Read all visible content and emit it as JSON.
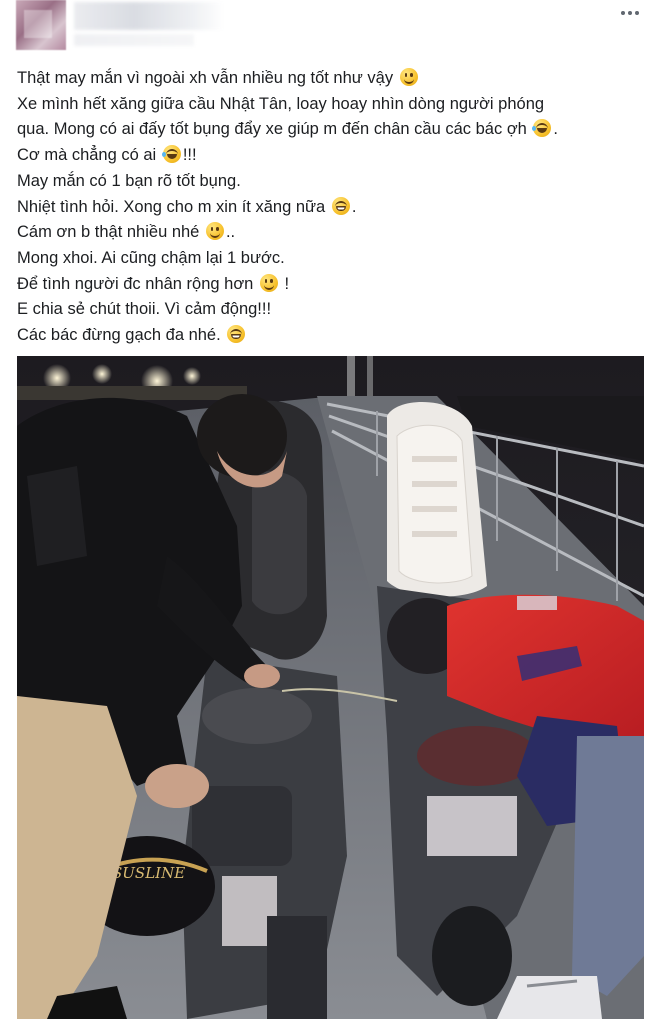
{
  "post": {
    "lines": [
      {
        "text": "Thật may mắn vì ngoài xh vẫn nhiều ng tốt như vậy",
        "emoji": "smile",
        "suffix": ""
      },
      {
        "text": "Xe mình hết xăng giữa cầu Nhật Tân, loay hoay nhìn dòng người phóng",
        "emoji": "",
        "suffix": ""
      },
      {
        "text": "qua. Mong có ai đấy tốt bụng đẩy xe giúp m đến chân cầu các bác ợh",
        "emoji": "laugh",
        "suffix": "."
      },
      {
        "text": "Cơ mà chẳng có ai",
        "emoji": "laugh",
        "suffix": "!!!"
      },
      {
        "text": "May mắn có 1 bạn rõ tốt bụng.",
        "emoji": "",
        "suffix": ""
      },
      {
        "text": "Nhiệt tình hỏi. Xong cho m xin ít xăng nữa",
        "emoji": "grin",
        "suffix": "."
      },
      {
        "text": "Cám ơn b thật nhiều nhé",
        "emoji": "smile",
        "suffix": ".."
      },
      {
        "text": "Mong xhoi. Ai cũng chậm lại 1 bước.",
        "emoji": "",
        "suffix": ""
      },
      {
        "text": "Để tình người đc nhân rộng hơn",
        "emoji": "smile",
        "suffix": " !"
      },
      {
        "text": "E chia sẻ chút thoii. Vì cảm động!!!",
        "emoji": "",
        "suffix": ""
      },
      {
        "text": "Các bác đừng gạch đa nhé.",
        "emoji": "grin",
        "suffix": ""
      }
    ]
  },
  "photo": {
    "helmet_text": "SUSLINE"
  },
  "icons": {
    "more": "more-horizontal-icon"
  },
  "colors": {
    "text": "#1c1e21",
    "jacket_red": "#d6242a",
    "night_sky": "#1b1a1e"
  }
}
